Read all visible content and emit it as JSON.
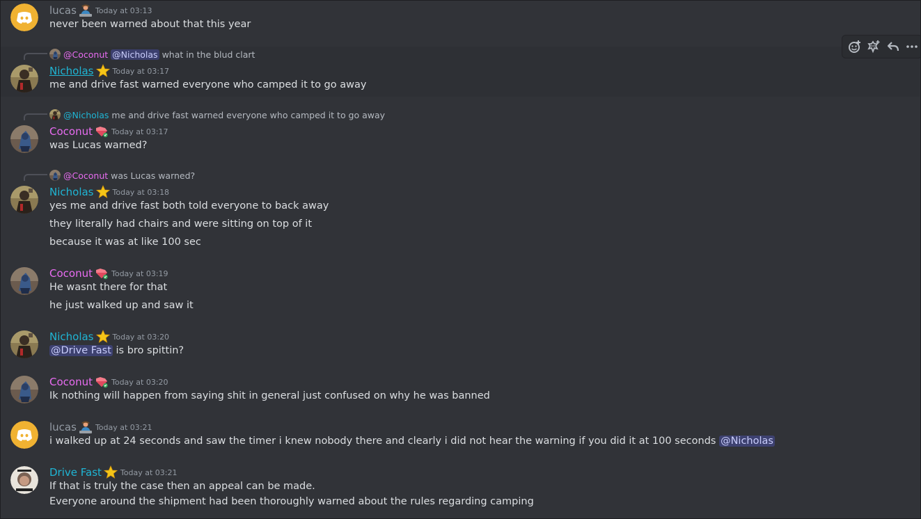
{
  "colors": {
    "background": "#313338",
    "hover_background": "#2e3035",
    "name_lucas": "#949ba4",
    "name_nicholas": "#1fb5d4",
    "name_coconut": "#e86cf1",
    "mention_bg": "rgba(88,101,242,0.3)"
  },
  "toolbar": {
    "icons": [
      "add-reaction-icon",
      "super-reaction-icon",
      "reply-icon",
      "more-icon"
    ]
  },
  "messages": [
    {
      "author": "lucas",
      "badge": "person-emoji",
      "time": "Today at 03:13",
      "lines": [
        "never been warned about that this year"
      ]
    },
    {
      "reply": {
        "author": "@Coconut",
        "mention": "@Nicholas",
        "text": "what in the blud clart"
      },
      "author": "Nicholas",
      "badge": "star-emoji",
      "time": "Today at 03:17",
      "lines": [
        "me and drive fast warned everyone who camped it to go away"
      ]
    },
    {
      "reply": {
        "author": "@Nicholas",
        "text": "me and drive fast warned everyone who camped it to go away"
      },
      "author": "Coconut",
      "badge": "gem-emoji",
      "time": "Today at 03:17",
      "lines": [
        "was Lucas warned?"
      ]
    },
    {
      "reply": {
        "author": "@Coconut",
        "text": "was Lucas warned?"
      },
      "author": "Nicholas",
      "badge": "star-emoji",
      "time": "Today at 03:18",
      "lines": [
        "yes me and drive fast both told everyone to back away",
        "they literally had chairs and were sitting on top of it",
        "because it was at like 100 sec"
      ]
    },
    {
      "author": "Coconut",
      "badge": "gem-emoji",
      "time": "Today at 03:19",
      "lines": [
        "He wasnt there for that",
        "he just walked up and saw it"
      ]
    },
    {
      "author": "Nicholas",
      "badge": "star-emoji",
      "time": "Today at 03:20",
      "mention": "@Drive Fast",
      "lines": [
        "is bro spittin?"
      ]
    },
    {
      "author": "Coconut",
      "badge": "gem-emoji",
      "time": "Today at 03:20",
      "lines": [
        "Ik nothing will happen from saying shit in general just confused on why he was banned"
      ]
    },
    {
      "author": "lucas",
      "badge": "person-emoji",
      "time": "Today at 03:21",
      "lines": [
        "i walked up at 24 seconds and saw the timer i knew nobody there and clearly i did not hear the warning if you did it at 100 seconds"
      ],
      "trailing_mention": "@Nicholas"
    },
    {
      "author": "Drive Fast",
      "badge": "star-emoji",
      "time": "Today at 03:21",
      "lines": [
        "If that is truly the case then an appeal can be made.",
        "Everyone around the shipment had been thoroughly warned about the rules regarding camping"
      ]
    }
  ]
}
